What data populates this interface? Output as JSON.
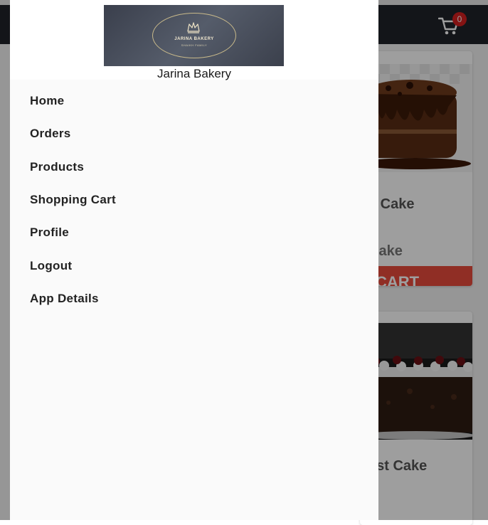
{
  "app": {
    "cart_count": "0",
    "products": [
      {
        "title": "e Cake",
        "subtitle": "Cake",
        "button": "CART"
      },
      {
        "title": "est Cake"
      }
    ]
  },
  "drawer": {
    "logo_text": "JARINA BAKERY",
    "logo_subtext": "SHAIKH FAMILY",
    "title": "Jarina Bakery",
    "items": [
      {
        "label": "Home"
      },
      {
        "label": "Orders"
      },
      {
        "label": "Products"
      },
      {
        "label": "Shopping Cart"
      },
      {
        "label": "Profile"
      },
      {
        "label": "Logout"
      },
      {
        "label": "App Details"
      }
    ]
  },
  "colors": {
    "topbar": "#1f2229",
    "accent": "#e84b3c",
    "badge": "#d51f1f",
    "drawer_bg": "#fafafa"
  }
}
